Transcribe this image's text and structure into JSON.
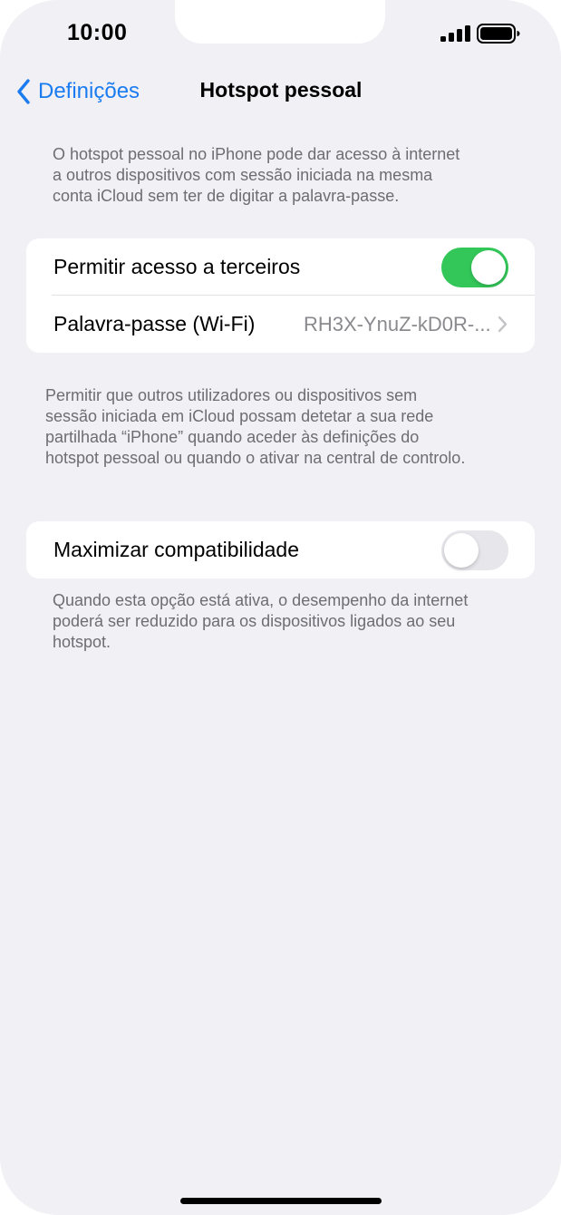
{
  "status_bar": {
    "time": "10:00",
    "signal_icon": "cellular-signal-icon",
    "battery_icon": "battery-icon"
  },
  "nav": {
    "back_label": "Definições",
    "back_icon": "chevron-left-icon",
    "title": "Hotspot pessoal"
  },
  "intro": {
    "lines": [
      "O hotspot pessoal no iPhone pode dar acesso à internet",
      "a outros dispositivos com sessão iniciada na mesma",
      "conta iCloud sem ter de digitar a palavra-passe."
    ]
  },
  "access_group": {
    "allow_others": {
      "label": "Permitir acesso a terceiros",
      "enabled": true
    },
    "password": {
      "label": "Palavra-passe (Wi-Fi)",
      "value": "RH3X-YnuZ-kD0R-...",
      "chevron_icon": "chevron-right-icon"
    },
    "footer_lines": [
      "Permitir que outros utilizadores ou dispositivos sem",
      "sessão iniciada em iCloud possam detetar a sua rede",
      "partilhada “iPhone” quando aceder às definições do",
      "hotspot pessoal ou quando o ativar na central de controlo."
    ]
  },
  "compat_group": {
    "maximize": {
      "label": "Maximizar compatibilidade",
      "enabled": false
    },
    "footer_lines": [
      "Quando esta opção está ativa, o desempenho da internet",
      "poderá ser reduzido para os dispositivos ligados ao seu",
      "hotspot."
    ]
  },
  "colors": {
    "accent": "#1a7cf0",
    "toggle_on": "#33c759",
    "toggle_off": "#e6e6eb",
    "background": "#f0f0f5",
    "secondary_text": "#6d6d72"
  }
}
